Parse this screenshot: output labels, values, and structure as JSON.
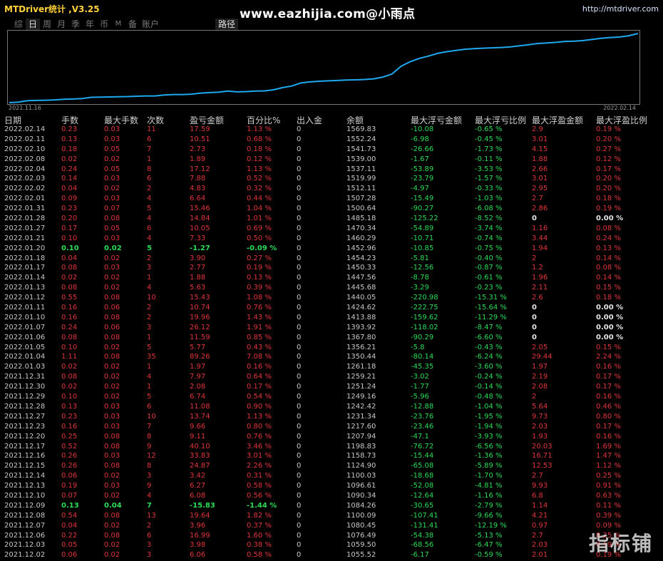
{
  "header": {
    "app_title": "MTDriver统计 ,V3.25",
    "site_url": "www.eazhijia.com@小雨点",
    "right_url": "http://mtdriver.com"
  },
  "tabs": [
    "综",
    "日",
    "周",
    "月",
    "季",
    "年",
    "币",
    "M",
    "备",
    "账户"
  ],
  "active_tab": "日",
  "path_tab": "路径",
  "chart_data": {
    "type": "line",
    "x_start_label": "2021.11.16",
    "x_end_label": "2022.02.14",
    "color": "#1fa8ee",
    "values": [
      1000,
      1004,
      1016,
      1018,
      1020,
      1023,
      1028,
      1030,
      1034,
      1044,
      1046,
      1047,
      1049,
      1050,
      1053,
      1055,
      1055,
      1063,
      1067,
      1067,
      1070,
      1079,
      1083,
      1087,
      1096,
      1089,
      1091,
      1095,
      1097,
      1106,
      1124,
      1137,
      1162,
      1171,
      1176,
      1180,
      1183,
      1186,
      1188,
      1191,
      1196,
      1211,
      1236,
      1300,
      1338,
      1365,
      1384,
      1406,
      1420,
      1430,
      1440,
      1445,
      1449,
      1452,
      1455,
      1460,
      1469,
      1478,
      1488,
      1492,
      1497,
      1505,
      1507,
      1512,
      1521,
      1531,
      1537,
      1541,
      1552,
      1570
    ]
  },
  "columns": [
    "日期",
    "手数",
    "最大手数",
    "次数",
    "盈亏金额",
    "百分比%",
    "出入金",
    "余额",
    "最大浮亏金额",
    "最大浮亏比例",
    "最大浮盈金额",
    "最大浮盈比例"
  ],
  "rows": [
    [
      "2022.02.14",
      "0.23",
      "0.03",
      "11",
      "17.59",
      "1.13 %",
      "0",
      "1569.83",
      "-10.08",
      "-0.65 %",
      "2.9",
      "0.19 %"
    ],
    [
      "2022.02.11",
      "0.13",
      "0.03",
      "6",
      "10.51",
      "0.68 %",
      "0",
      "1552.24",
      "-6.98",
      "-0.45 %",
      "3.01",
      "0.20 %"
    ],
    [
      "2022.02.10",
      "0.18",
      "0.05",
      "7",
      "2.73",
      "0.18 %",
      "0",
      "1541.73",
      "-26.66",
      "-1.73 %",
      "4.15",
      "0.27 %"
    ],
    [
      "2022.02.08",
      "0.02",
      "0.02",
      "1",
      "1.89",
      "0.12 %",
      "0",
      "1539.00",
      "-1.67",
      "-0.11 %",
      "1.88",
      "0.12 %"
    ],
    [
      "2022.02.04",
      "0.24",
      "0.05",
      "8",
      "17.12",
      "1.13 %",
      "0",
      "1537.11",
      "-53.89",
      "-3.53 %",
      "2.66",
      "0.17 %"
    ],
    [
      "2022.02.03",
      "0.14",
      "0.03",
      "6",
      "7.88",
      "0.52 %",
      "0",
      "1519.99",
      "-23.79",
      "-1.57 %",
      "3.01",
      "0.20 %"
    ],
    [
      "2022.02.02",
      "0.04",
      "0.02",
      "2",
      "4.83",
      "0.32 %",
      "0",
      "1512.11",
      "-4.97",
      "-0.33 %",
      "2.95",
      "0.20 %"
    ],
    [
      "2022.02.01",
      "0.09",
      "0.03",
      "4",
      "6.64",
      "0.44 %",
      "0",
      "1507.28",
      "-15.49",
      "-1.03 %",
      "2.7",
      "0.18 %"
    ],
    [
      "2022.01.31",
      "0.23",
      "0.07",
      "5",
      "15.46",
      "1.04 %",
      "0",
      "1500.64",
      "-90.27",
      "-6.08 %",
      "2.86",
      "0.19 %"
    ],
    [
      "2022.01.28",
      "0.20",
      "0.08",
      "4",
      "14.84",
      "1.01 %",
      "0",
      "1485.18",
      "-125.22",
      "-8.52 %",
      "0",
      "0.00 %"
    ],
    [
      "2022.01.27",
      "0.17",
      "0.05",
      "6",
      "10.05",
      "0.69 %",
      "0",
      "1470.34",
      "-54.89",
      "-3.74 %",
      "1.16",
      "0.08 %"
    ],
    [
      "2022.01.21",
      "0.10",
      "0.03",
      "4",
      "7.33",
      "0.50 %",
      "0",
      "1460.29",
      "-10.71",
      "-0.74 %",
      "3.44",
      "0.24 %"
    ],
    [
      "2022.01.20",
      "0.10",
      "0.02",
      "5",
      "-1.27",
      "-0.09 %",
      "0",
      "1452.96",
      "-10.85",
      "-0.75 %",
      "1.94",
      "0.13 %"
    ],
    [
      "2022.01.18",
      "0.04",
      "0.02",
      "2",
      "3.90",
      "0.27 %",
      "0",
      "1454.23",
      "-5.81",
      "-0.40 %",
      "2",
      "0.14 %"
    ],
    [
      "2022.01.17",
      "0.08",
      "0.03",
      "3",
      "2.77",
      "0.19 %",
      "0",
      "1450.33",
      "-12.56",
      "-0.87 %",
      "1.2",
      "0.08 %"
    ],
    [
      "2022.01.14",
      "0.02",
      "0.02",
      "1",
      "1.88",
      "0.13 %",
      "0",
      "1447.56",
      "-8.78",
      "-0.61 %",
      "1.96",
      "0.14 %"
    ],
    [
      "2022.01.13",
      "0.08",
      "0.02",
      "4",
      "5.63",
      "0.39 %",
      "0",
      "1445.68",
      "-3.29",
      "-0.23 %",
      "2.11",
      "0.15 %"
    ],
    [
      "2022.01.12",
      "0.55",
      "0.08",
      "10",
      "15.43",
      "1.08 %",
      "0",
      "1440.05",
      "-220.98",
      "-15.31 %",
      "2.6",
      "0.18 %"
    ],
    [
      "2022.01.11",
      "0.16",
      "0.06",
      "2",
      "10.74",
      "0.76 %",
      "0",
      "1424.62",
      "-222.75",
      "-15.64 %",
      "0",
      "0.00 %"
    ],
    [
      "2022.01.10",
      "0.16",
      "0.08",
      "2",
      "19.96",
      "1.43 %",
      "0",
      "1413.88",
      "-159.62",
      "-11.29 %",
      "0",
      "0.00 %"
    ],
    [
      "2022.01.07",
      "0.24",
      "0.06",
      "3",
      "26.12",
      "1.91 %",
      "0",
      "1393.92",
      "-118.02",
      "-8.47 %",
      "0",
      "0.00 %"
    ],
    [
      "2022.01.06",
      "0.08",
      "0.08",
      "1",
      "11.59",
      "0.85 %",
      "0",
      "1367.80",
      "-90.29",
      "-6.60 %",
      "0",
      "0.00 %"
    ],
    [
      "2022.01.05",
      "0.10",
      "0.02",
      "5",
      "5.77",
      "0.43 %",
      "0",
      "1356.21",
      "-5.8",
      "-0.43 %",
      "2.05",
      "0.15 %"
    ],
    [
      "2022.01.04",
      "1.11",
      "0.08",
      "35",
      "89.26",
      "7.08 %",
      "0",
      "1350.44",
      "-80.14",
      "-6.24 %",
      "29.44",
      "2.24 %"
    ],
    [
      "2022.01.03",
      "0.02",
      "0.02",
      "1",
      "1.97",
      "0.16 %",
      "0",
      "1261.18",
      "-45.35",
      "-3.60 %",
      "1.97",
      "0.16 %"
    ],
    [
      "2021.12.31",
      "0.08",
      "0.02",
      "4",
      "7.97",
      "0.64 %",
      "0",
      "1259.21",
      "-3.02",
      "-0.24 %",
      "2.19",
      "0.17 %"
    ],
    [
      "2021.12.30",
      "0.02",
      "0.02",
      "1",
      "2.08",
      "0.17 %",
      "0",
      "1251.24",
      "-1.77",
      "-0.14 %",
      "2.08",
      "0.17 %"
    ],
    [
      "2021.12.29",
      "0.10",
      "0.02",
      "5",
      "6.74",
      "0.54 %",
      "0",
      "1249.16",
      "-5.96",
      "-0.48 %",
      "2",
      "0.16 %"
    ],
    [
      "2021.12.28",
      "0.13",
      "0.03",
      "6",
      "11.08",
      "0.90 %",
      "0",
      "1242.42",
      "-12.88",
      "-1.04 %",
      "5.64",
      "0.46 %"
    ],
    [
      "2021.12.27",
      "0.23",
      "0.03",
      "10",
      "13.74",
      "1.13 %",
      "0",
      "1231.34",
      "-23.76",
      "-1.95 %",
      "9.73",
      "0.80 %"
    ],
    [
      "2021.12.23",
      "0.16",
      "0.03",
      "7",
      "9.66",
      "0.80 %",
      "0",
      "1217.60",
      "-23.46",
      "-1.94 %",
      "2.03",
      "0.17 %"
    ],
    [
      "2021.12.20",
      "0.25",
      "0.08",
      "8",
      "9.11",
      "0.76 %",
      "0",
      "1207.94",
      "-47.1",
      "-3.93 %",
      "1.93",
      "0.16 %"
    ],
    [
      "2021.12.17",
      "0.52",
      "0.08",
      "9",
      "40.10",
      "3.46 %",
      "0",
      "1198.83",
      "-76.72",
      "-6.56 %",
      "20.03",
      "1.69 %"
    ],
    [
      "2021.12.16",
      "0.26",
      "0.03",
      "12",
      "33.83",
      "3.01 %",
      "0",
      "1158.73",
      "-15.44",
      "-1.36 %",
      "16.71",
      "1.47 %"
    ],
    [
      "2021.12.15",
      "0.26",
      "0.08",
      "8",
      "24.87",
      "2.26 %",
      "0",
      "1124.90",
      "-65.08",
      "-5.89 %",
      "12.53",
      "1.12 %"
    ],
    [
      "2021.12.14",
      "0.06",
      "0.02",
      "3",
      "3.42",
      "0.31 %",
      "0",
      "1100.03",
      "-18.68",
      "-1.70 %",
      "2.7",
      "0.25 %"
    ],
    [
      "2021.12.13",
      "0.19",
      "0.03",
      "9",
      "6.27",
      "0.58 %",
      "0",
      "1096.61",
      "-52.08",
      "-4.81 %",
      "9.93",
      "0.91 %"
    ],
    [
      "2021.12.10",
      "0.07",
      "0.02",
      "4",
      "6.08",
      "0.56 %",
      "0",
      "1090.34",
      "-12.64",
      "-1.16 %",
      "6.8",
      "0.63 %"
    ],
    [
      "2021.12.09",
      "0.13",
      "0.04",
      "7",
      "-15.83",
      "-1.44 %",
      "0",
      "1084.26",
      "-30.65",
      "-2.79 %",
      "1.14",
      "0.11 %"
    ],
    [
      "2021.12.08",
      "0.54",
      "0.08",
      "13",
      "19.64",
      "1.82 %",
      "0",
      "1100.09",
      "-107.41",
      "-9.66 %",
      "4.21",
      "0.39 %"
    ],
    [
      "2021.12.07",
      "0.04",
      "0.02",
      "2",
      "3.96",
      "0.37 %",
      "0",
      "1080.45",
      "-131.41",
      "-12.19 %",
      "0.97",
      "0.09 %"
    ],
    [
      "2021.12.06",
      "0.22",
      "0.08",
      "6",
      "16.99",
      "1.60 %",
      "0",
      "1076.49",
      "-54.38",
      "-5.13 %",
      "2.7",
      "0.25 %"
    ],
    [
      "2021.12.03",
      "0.05",
      "0.02",
      "3",
      "3.98",
      "0.38 %",
      "0",
      "1059.50",
      "-68.56",
      "-6.47 %",
      "2.03",
      "0.19 %"
    ],
    [
      "2021.12.02",
      "0.06",
      "0.02",
      "3",
      "6.06",
      "0.58 %",
      "0",
      "1055.52",
      "-6.17",
      "-0.59 %",
      "2.01",
      "0.19 %"
    ]
  ],
  "watermark": "指标铺"
}
